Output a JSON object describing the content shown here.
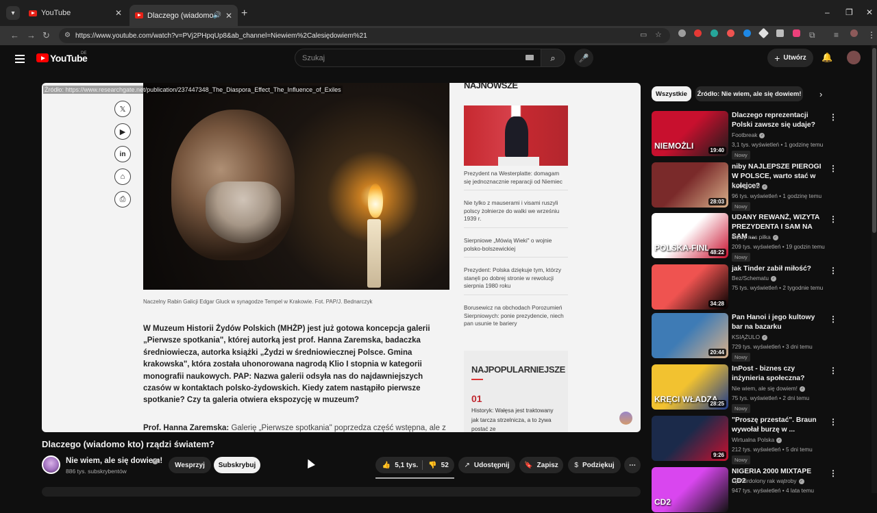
{
  "browser": {
    "tabs": [
      {
        "label": "YouTube"
      },
      {
        "label": "Dlaczego (wiadomo kto) rz"
      }
    ],
    "url": "https://www.youtube.com/watch?v=PVj2PHpqUp8&ab_channel=Niewiem%2Calesiędowiem%21",
    "window_controls": {
      "minimize": "–",
      "restore": "❐",
      "close": "✕"
    }
  },
  "youtube_header": {
    "logo": "YouTube",
    "logo_region": "DE",
    "search_placeholder": "Szukaj",
    "create_label": "Utwórz"
  },
  "video": {
    "source_overlay": "Źródło: https://www.researchgate.net/publication/237447348_The_Diaspora_Effect_The_Influence_of_Exiles",
    "photo_caption": "Naczelny Rabin Galicji Edgar Gluck w synagodze Tempel w Krakowie. Fot. PAP/J. Bednarczyk",
    "article_bold": "W Muzeum Historii Żydów Polskich (MHŻP) jest już gotowa koncepcja galerii „Pierwsze spotkania\", której autorką jest prof. Hanna Zaremska, badaczka średniowiecza, autorka książki „Żydzi w średniowiecznej Polsce. Gmina krakowska\", która została uhonorowana nagrodą Klio I stopnia w kategorii monografii naukowych. PAP: Nazwa galerii odsyła nas do najdawniejszych czasów w kontaktach polsko-żydowskich. Kiedy zatem nastąpiło pierwsze spotkanie? Czy ta galeria otwiera ekspozycję w muzeum?",
    "article_speaker": "Prof. Hanna Zaremska:",
    "article_rest": " Galerię „Pierwsze spotkania\" poprzedza część wstępna, ale z",
    "right_heading": "NAJNOWSZE",
    "right_items": [
      "Prezydent na Westerplatte: domagam się jednoznacznie reparacji od Niemiec",
      "Nie tylko z mauserami i visami ruszyli polscy żołnierze do walki we wrześniu 1939 r.",
      "Sierpniowe „Mówią Wieki\" o wojnie polsko-bolszewickiej",
      "Prezydent: Polska dziękuje tym, którzy stanęli po dobrej stronie w rewolucji sierpnia 1980 roku",
      "Borusewicz na obchodach Porozumień Sierpniowych: ponie prezydencie, niech pan usunie te bariery"
    ],
    "popular_heading": "NAJPOPULARNIEJSZE",
    "popular_num": "01",
    "popular_text": "Historyk: Wałęsa jest traktowany jak tarcza strzelnicza, a to żywa postać ze"
  },
  "video_info": {
    "title": "Dlaczego (wiadomo kto) rządzi światem?",
    "channel": "Nie wiem, ale się dowiem!",
    "subscribers": "886 tys. subskrybentów",
    "support_label": "Wesprzyj",
    "subscribe_label": "Subskrybuj",
    "likes": "5,1 tys.",
    "dislikes": "52",
    "share_label": "Udostępnij",
    "save_label": "Zapisz",
    "thanks_label": "Podziękuj"
  },
  "sidebar": {
    "chips": [
      "Wszystkie",
      "Źródło: Nie wiem, ale się dowiem!"
    ],
    "recommendations": [
      {
        "title": "Dlaczego reprezentacji Polski zawsze się udaje?",
        "channel": "Footbreak",
        "meta": "3,1 tys. wyświetleń • 1 godzinę temu",
        "badge": "Nowy",
        "duration": "19:40",
        "thumb_text": "NIEMOŻLI",
        "colors": [
          "#c8102e",
          "#1b1b1b"
        ]
      },
      {
        "title": "niby NAJLEPSZE PIEROGI W POLSCE, warto stać w kolejce?",
        "channel": "KSIĄŻULO",
        "meta": "96 tys. wyświetleń • 1 godzinę temu",
        "badge": "Nowy",
        "duration": "28:03",
        "thumb_text": "",
        "colors": [
          "#7a2a2a",
          "#d8b08a"
        ]
      },
      {
        "title": "UDANY REWANŻ, WIZYTA PREZYDENTA I SAM NA SAM ...",
        "channel": "Łączy nas piłka",
        "meta": "209 tys. wyświetleń • 19 godzin temu",
        "badge": "Nowy",
        "duration": "48:22",
        "thumb_text": "POLSKA-FINL",
        "colors": [
          "#ffffff",
          "#c8102e"
        ]
      },
      {
        "title": "jak Tinder zabił miłość?",
        "channel": "Bez/Schematu",
        "meta": "75 tys. wyświetleń • 2 tygodnie temu",
        "badge": "",
        "duration": "34:28",
        "thumb_text": "",
        "colors": [
          "#ef5350",
          "#000000"
        ]
      },
      {
        "title": "Pan Hanoi i jego kultowy bar na bazarku",
        "channel": "KSIĄŻULO",
        "meta": "729 tys. wyświetleń • 3 dni temu",
        "badge": "Nowy",
        "duration": "20:44",
        "thumb_text": "",
        "colors": [
          "#3e7bb5",
          "#d8b08a"
        ]
      },
      {
        "title": "InPost - biznes czy inżynieria społeczna?",
        "channel": "Nie wiem, ale się dowiem!",
        "meta": "75 tys. wyświetleń • 2 dni temu",
        "badge": "Nowy",
        "duration": "28:25",
        "thumb_text": "KRĘCI  WŁADZA",
        "colors": [
          "#f2c230",
          "#1e3a8a"
        ]
      },
      {
        "title": "\"Proszę przestać\". Braun wywołał burzę w ...",
        "channel": "Wirtualna Polska",
        "meta": "212 tys. wyświetleń • 5 dni temu",
        "badge": "Nowy",
        "duration": "9:26",
        "thumb_text": "",
        "colors": [
          "#1b2a4a",
          "#c8102e"
        ]
      },
      {
        "title": "NIGERIA 2000 MIXTAPE CD2",
        "channel": "Dj Peirdolony rak wątroby",
        "meta": "947 tys. wyświetleń • 4 lata temu",
        "badge": "",
        "duration": "",
        "thumb_text": "CD2",
        "colors": [
          "#d946ef",
          "#111111"
        ]
      }
    ]
  }
}
